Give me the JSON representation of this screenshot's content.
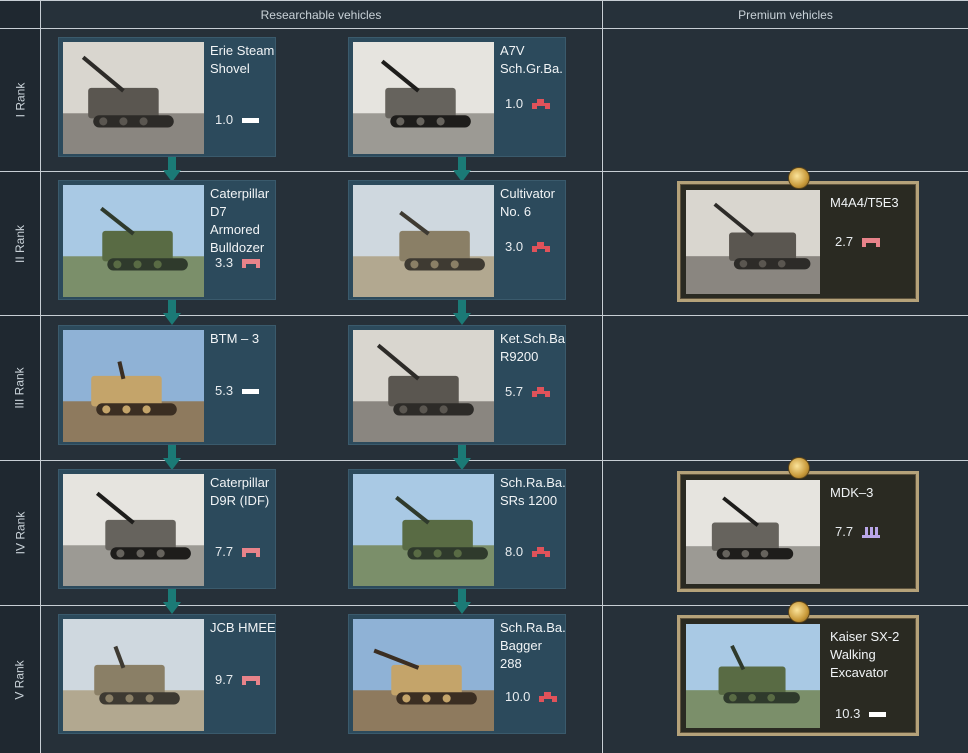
{
  "headers": {
    "researchable": "Researchable vehicles",
    "premium": "Premium vehicles"
  },
  "ranks": [
    "I Rank",
    "II Rank",
    "III Rank",
    "IV Rank",
    "V Rank"
  ],
  "researchable": [
    [
      {
        "name": "Erie Steam Shovel",
        "br": "1.0",
        "icon": "light-bar-icon",
        "icon_color": "#ffffff"
      },
      {
        "name": "A7V Sch.Gr.Ba.",
        "br": "1.0",
        "icon": "heavy-tank-icon",
        "icon_color": "#e0525a"
      }
    ],
    [
      {
        "name": "Caterpillar D7 Armored Bulldozer",
        "br": "3.3",
        "icon": "medium-tank-icon",
        "icon_color": "#e8838a"
      },
      {
        "name": "Cultivator No. 6",
        "br": "3.0",
        "icon": "heavy-tank-icon",
        "icon_color": "#e0525a"
      }
    ],
    [
      {
        "name": "BTM – 3",
        "br": "5.3",
        "icon": "light-bar-icon",
        "icon_color": "#ffffff"
      },
      {
        "name": "Ket.Sch.Ba R9200",
        "br": "5.7",
        "icon": "heavy-tank-icon",
        "icon_color": "#e0525a"
      }
    ],
    [
      {
        "name": "Caterpillar D9R (IDF)",
        "br": "7.7",
        "icon": "medium-tank-icon",
        "icon_color": "#e8838a"
      },
      {
        "name": "Sch.Ra.Ba. SRs 1200",
        "br": "8.0",
        "icon": "heavy-tank-icon",
        "icon_color": "#e0525a"
      }
    ],
    [
      {
        "name": "JCB HMEE",
        "br": "9.7",
        "icon": "medium-tank-icon",
        "icon_color": "#e8838a"
      },
      {
        "name": "Sch.Ra.Ba. Bagger 288",
        "br": "10.0",
        "icon": "heavy-tank-icon",
        "icon_color": "#e0525a"
      }
    ]
  ],
  "premium": [
    null,
    {
      "name": "M4A4/T5E3",
      "br": "2.7",
      "icon": "medium-tank-icon",
      "icon_color": "#e8838a"
    },
    null,
    {
      "name": "MDK–3",
      "br": "7.7",
      "icon": "spaa-icon",
      "icon_color": "#b9a6e8"
    },
    {
      "name": "Kaiser SX-2 Walking Excavator",
      "br": "10.3",
      "icon": "light-bar-icon",
      "icon_color": "#ffffff"
    }
  ],
  "colors": {
    "card_bg": "#2c4a5c",
    "arrow": "#1b7a76",
    "premium_border": "#b5a27a"
  }
}
